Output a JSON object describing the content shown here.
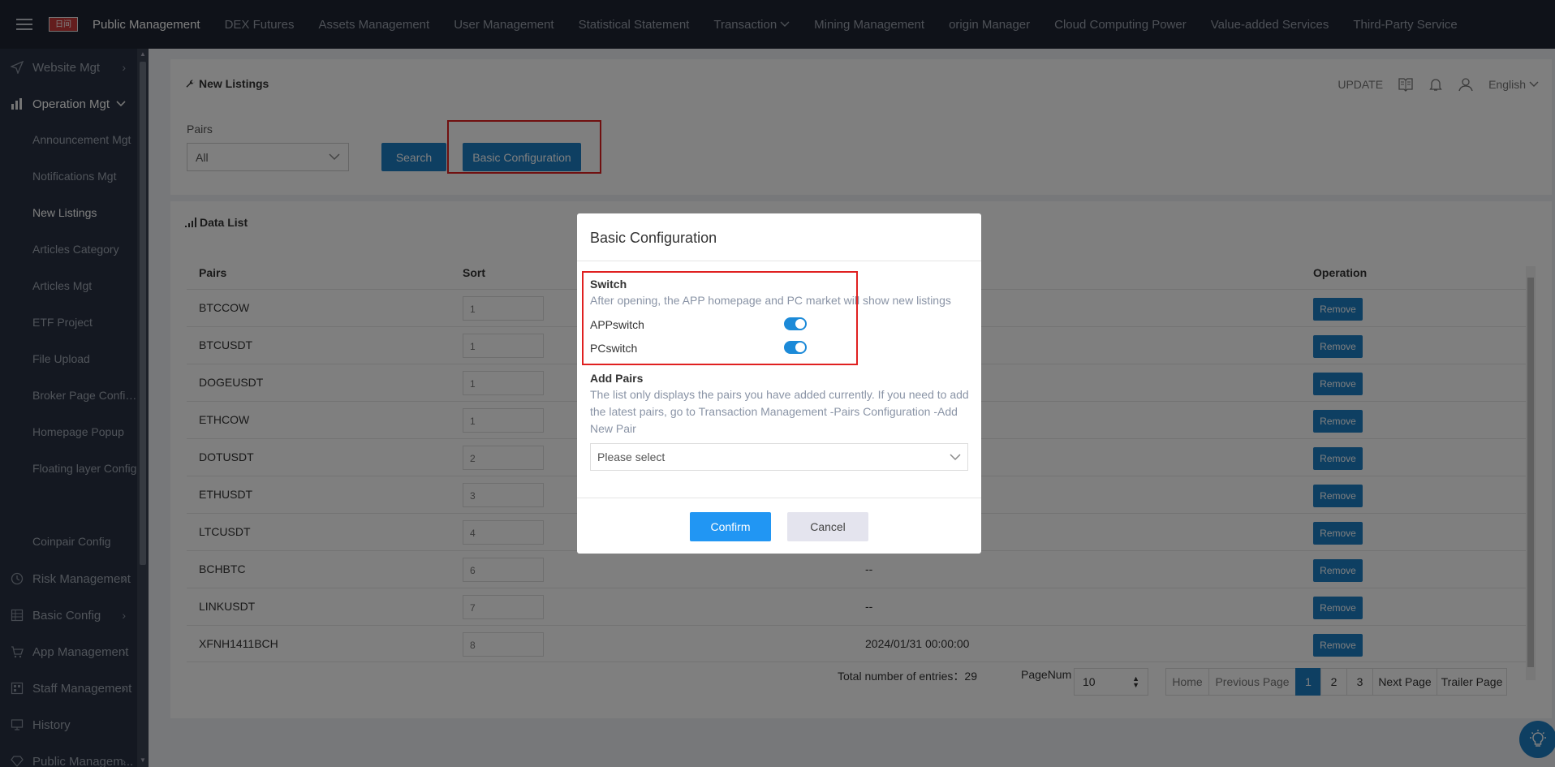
{
  "topbar": {
    "logo_text": "日间",
    "nav": [
      {
        "label": "Public Management",
        "active": true
      },
      {
        "label": "DEX Futures"
      },
      {
        "label": "Assets Management"
      },
      {
        "label": "User Management"
      },
      {
        "label": "Statistical Statement"
      },
      {
        "label": "Transaction"
      },
      {
        "label": "Mining Management"
      },
      {
        "label": "origin Manager"
      },
      {
        "label": "Cloud Computing Power"
      },
      {
        "label": "Value-added Services"
      },
      {
        "label": "Third-Party Service"
      }
    ]
  },
  "sidebar": {
    "items": [
      {
        "label": "Website Mgt",
        "icon": "send-icon"
      },
      {
        "label": "Operation Mgt",
        "icon": "bar-chart-icon"
      },
      {
        "label": "Risk Management",
        "icon": "clock-icon"
      },
      {
        "label": "Basic Config",
        "icon": "table-icon"
      },
      {
        "label": "App Management",
        "icon": "cart-icon"
      },
      {
        "label": "Staff Management",
        "icon": "grid-icon"
      },
      {
        "label": "History",
        "icon": "monitor-icon"
      },
      {
        "label": "Public Managem...",
        "icon": "gem-icon"
      }
    ],
    "sub": [
      "Announcement Mgt",
      "Notifications Mgt",
      "New Listings",
      "Articles Category",
      "Articles Mgt",
      "ETF Project",
      "File Upload",
      "Broker Page Config...",
      "Homepage Popup",
      "Floating layer Config",
      "Coinpair Config"
    ]
  },
  "page": {
    "title": "New Listings",
    "update": "UPDATE",
    "language": "English",
    "pairs_label": "Pairs",
    "pairs_value": "All",
    "search": "Search",
    "basic_config": "Basic Configuration",
    "data_list": "Data List"
  },
  "table": {
    "headers": {
      "pairs": "Pairs",
      "sort": "Sort",
      "operation": "Operation"
    },
    "remove_label": "Remove",
    "rows": [
      {
        "pair": "BTCCOW",
        "sort": "1",
        "time": ""
      },
      {
        "pair": "BTCUSDT",
        "sort": "1",
        "time": ""
      },
      {
        "pair": "DOGEUSDT",
        "sort": "1",
        "time": ""
      },
      {
        "pair": "ETHCOW",
        "sort": "1",
        "time": ""
      },
      {
        "pair": "DOTUSDT",
        "sort": "2",
        "time": ""
      },
      {
        "pair": "ETHUSDT",
        "sort": "3",
        "time": ""
      },
      {
        "pair": "LTCUSDT",
        "sort": "4",
        "time": ""
      },
      {
        "pair": "BCHBTC",
        "sort": "6",
        "time": "--"
      },
      {
        "pair": "LINKUSDT",
        "sort": "7",
        "time": "--"
      },
      {
        "pair": "XFNH1411BCH",
        "sort": "8",
        "time": "2024/01/31 00:00:00"
      }
    ]
  },
  "pagination": {
    "total_label": "Total number of entries：",
    "total": "29",
    "pagenum_label": "PageNum",
    "pagenum": "10",
    "home": "Home",
    "prev": "Previous Page",
    "pages": [
      "1",
      "2",
      "3"
    ],
    "next": "Next Page",
    "trailer": "Trailer Page"
  },
  "modal": {
    "title": "Basic Configuration",
    "switch_title": "Switch",
    "switch_desc": "After opening, the APP homepage and PC market will show new listings",
    "app_switch": "APPswitch",
    "pc_switch": "PCswitch",
    "app_on": true,
    "pc_on": true,
    "add_pairs_title": "Add Pairs",
    "add_pairs_desc": "The list only displays the pairs you have added currently. If you need to add the latest pairs, go to Transaction Management -Pairs Configuration -Add New Pair",
    "select_placeholder": "Please select",
    "confirm": "Confirm",
    "cancel": "Cancel"
  },
  "colors": {
    "primary": "#1c7ec5",
    "highlight": "#e02020",
    "topbar": "#1e2533",
    "sidebar": "#283142"
  }
}
